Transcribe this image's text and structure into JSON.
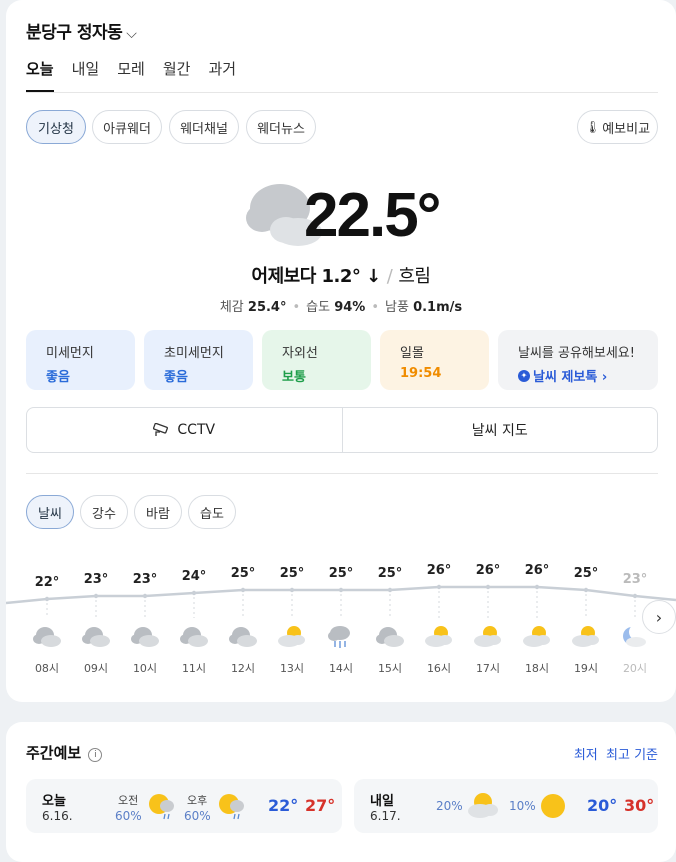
{
  "location": {
    "name": "분당구 정자동"
  },
  "tabs": [
    "오늘",
    "내일",
    "모레",
    "월간",
    "과거"
  ],
  "sources": [
    "기상청",
    "아큐웨더",
    "웨더채널",
    "웨더뉴스"
  ],
  "compare_label": "예보비교",
  "current": {
    "temp": "22.5°",
    "vs_yesterday": "어제보다 1.2° ↓",
    "sep": "/",
    "condition": "흐림",
    "feels_label": "체감",
    "feels": "25.4°",
    "humidity_label": "습도",
    "humidity": "94%",
    "wind_label": "남풍",
    "wind": "0.1m/s"
  },
  "info_cards": [
    {
      "label": "미세먼지",
      "value": "좋음",
      "bg": "#e8f0fd",
      "color": "#2a6bd9"
    },
    {
      "label": "초미세먼지",
      "value": "좋음",
      "bg": "#e8f0fd",
      "color": "#2a6bd9"
    },
    {
      "label": "자외선",
      "value": "보통",
      "bg": "#e6f6ea",
      "color": "#1e9e4a"
    },
    {
      "label": "일몰",
      "value": "19:54",
      "bg": "#fdf3e3",
      "color": "#f08c00"
    },
    {
      "label": "날씨를 공유해보세요!",
      "value": "날씨 제보톡 ›",
      "bg": "#f2f3f5",
      "color": "#2a5bd7"
    }
  ],
  "buttons": {
    "cctv": "CCTV",
    "map": "날씨 지도"
  },
  "graph_tabs": [
    "날씨",
    "강수",
    "바람",
    "습도"
  ],
  "hourly": {
    "hours": [
      "08시",
      "09시",
      "10시",
      "11시",
      "12시",
      "13시",
      "14시",
      "15시",
      "16시",
      "17시",
      "18시",
      "19시",
      "20시"
    ],
    "temps": [
      22,
      23,
      23,
      24,
      25,
      25,
      25,
      25,
      26,
      26,
      26,
      25,
      23
    ],
    "temp_labels": [
      "22°",
      "23°",
      "23°",
      "24°",
      "25°",
      "25°",
      "25°",
      "25°",
      "26°",
      "26°",
      "26°",
      "25°",
      "23°"
    ],
    "icons": [
      "cloud-icon",
      "cloud-icon",
      "cloud-icon",
      "cloud-icon",
      "cloud-icon",
      "partly-cloudy-icon",
      "rain-icon",
      "cloud-icon",
      "partly-cloudy-icon",
      "partly-cloudy-icon",
      "partly-cloudy-icon",
      "partly-cloudy-icon",
      "moon-icon"
    ]
  },
  "weekly": {
    "title": "주간예보",
    "sort": "최저  최고 기준",
    "days": [
      {
        "day": "오늘",
        "date": "6.16.",
        "am_label": "오전",
        "am_pct": "60%",
        "pm_label": "오후",
        "pm_pct": "60%",
        "low": "22°",
        "high": "27°"
      },
      {
        "day": "내일",
        "date": "6.17.",
        "am_pct": "20%",
        "pm_pct": "10%",
        "low": "20°",
        "high": "30°"
      }
    ]
  }
}
